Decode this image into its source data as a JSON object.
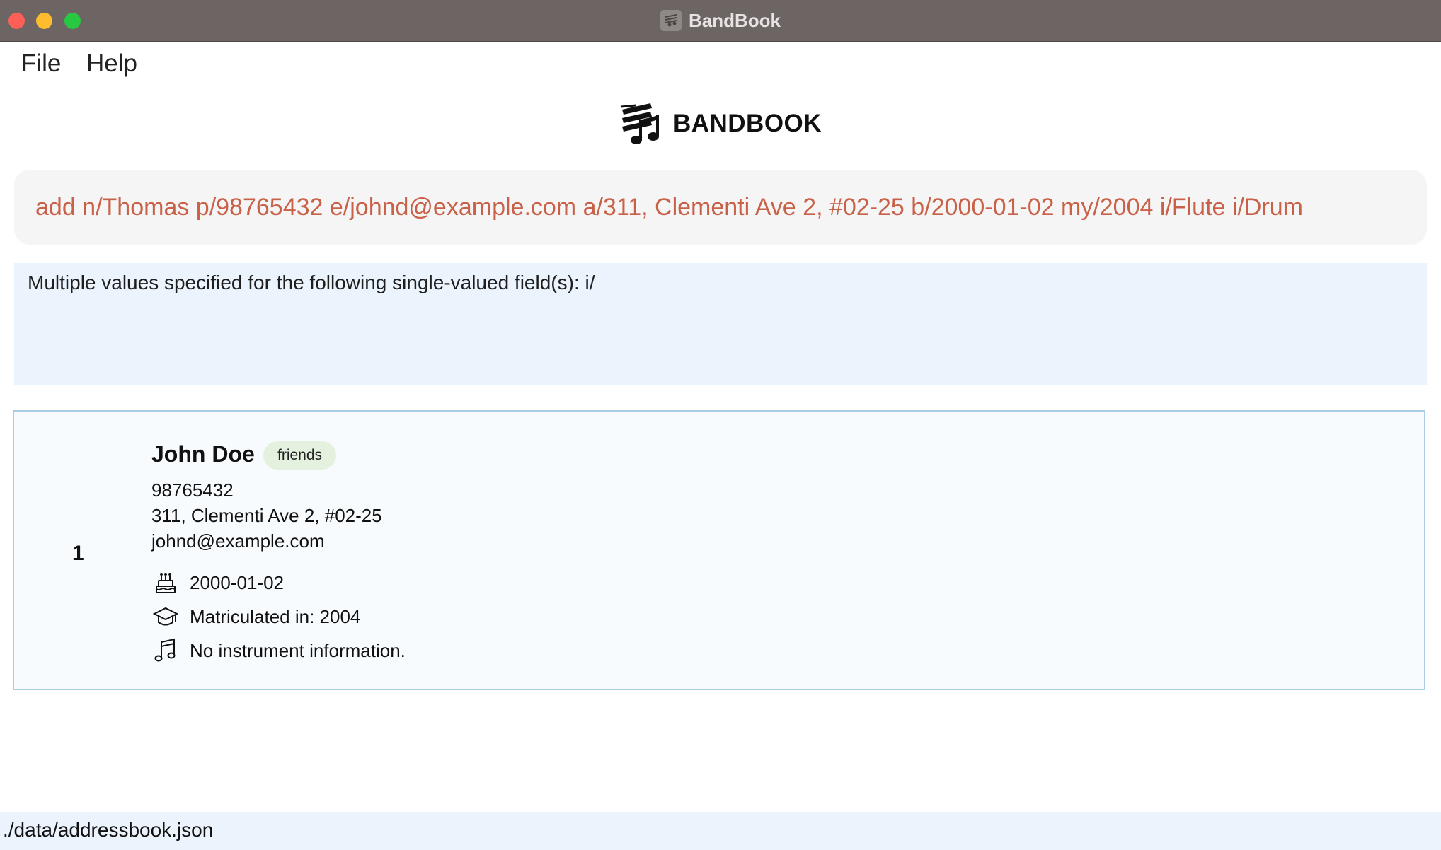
{
  "window": {
    "title": "BandBook"
  },
  "menu": {
    "file": "File",
    "help": "Help"
  },
  "logo": {
    "text": "BANDBOOK"
  },
  "command": {
    "value": "add n/Thomas p/98765432 e/johnd@example.com a/311, Clementi Ave 2, #02-25 b/2000-01-02 my/2004 i/Flute i/Drum",
    "color": "#c96148"
  },
  "result": {
    "message": "Multiple values specified for the following single-valued field(s): i/"
  },
  "persons": [
    {
      "index": "1",
      "name": "John Doe",
      "tags": [
        "friends"
      ],
      "phone": "98765432",
      "address": "311, Clementi Ave 2, #02-25",
      "email": "johnd@example.com",
      "birthday": "2000-01-02",
      "matriculation": "Matriculated in: 2004",
      "instrument": "No instrument information.",
      "icons": {
        "birthday": "birthday-cake-icon",
        "matriculation": "graduation-cap-icon",
        "instrument": "music-note-icon"
      }
    }
  ],
  "status": {
    "path": "./data/addressbook.json"
  }
}
